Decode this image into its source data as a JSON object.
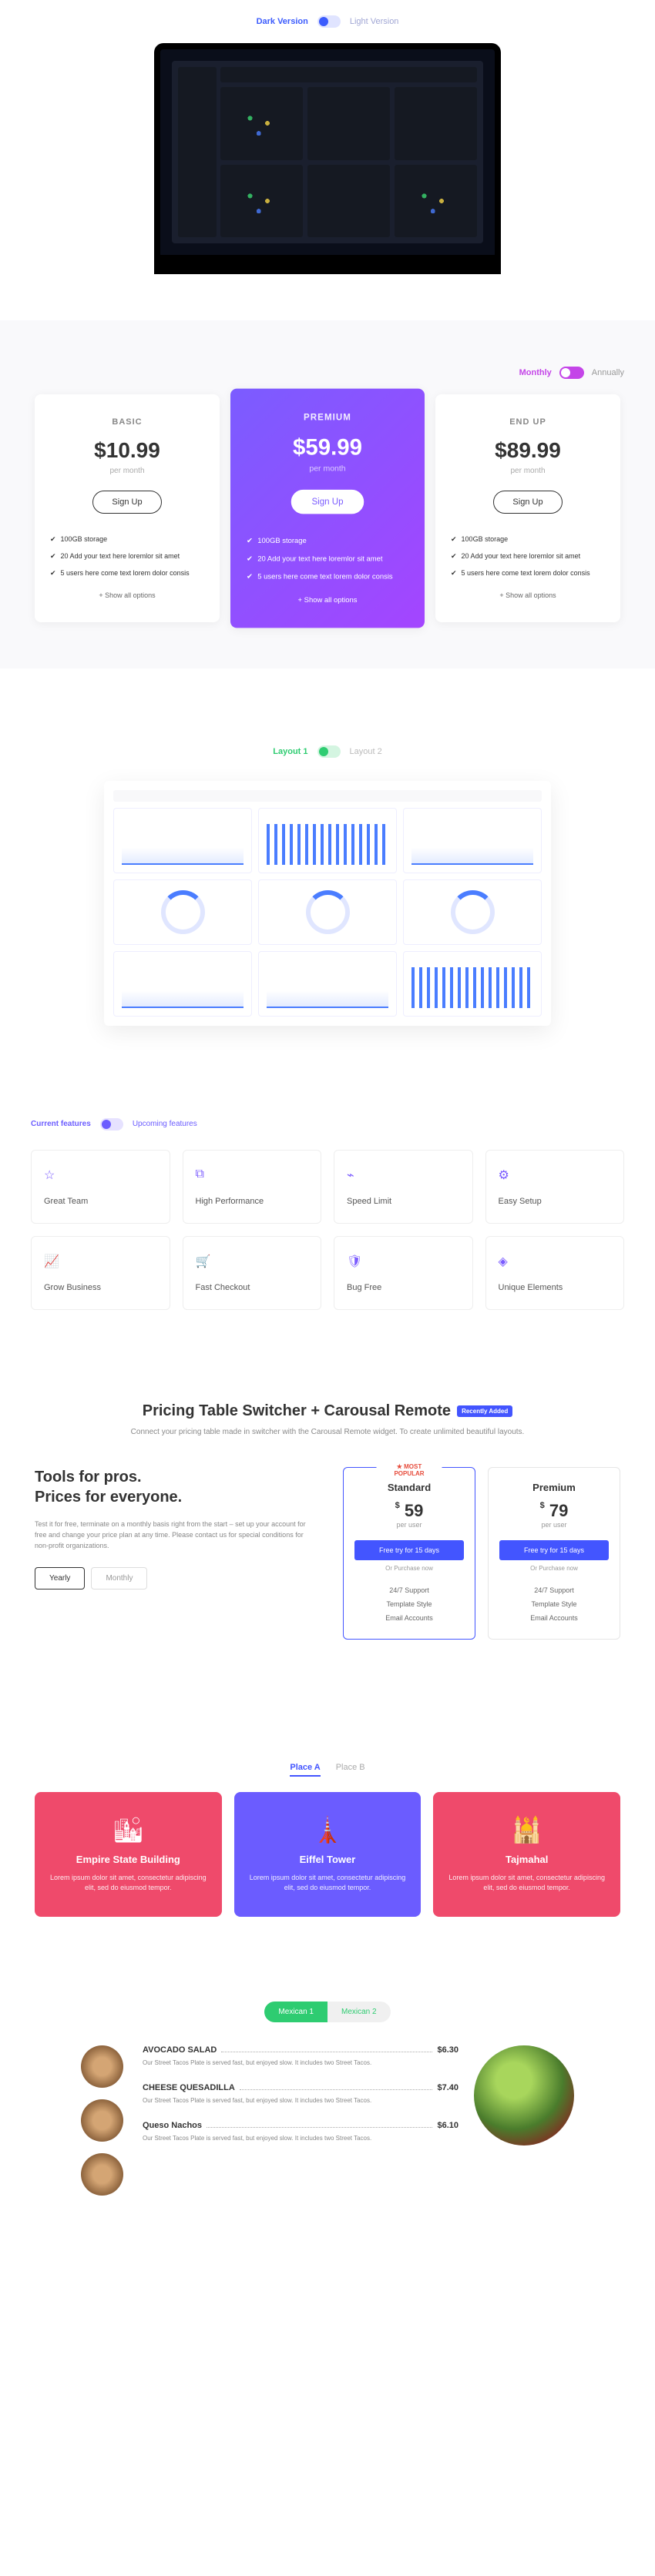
{
  "theme": {
    "dark": "Dark Version",
    "light": "Light Version"
  },
  "billing": {
    "monthly": "Monthly",
    "annually": "Annually"
  },
  "pricing1": [
    {
      "name": "BASIC",
      "price": "$10.99",
      "per": "per month",
      "btn": "Sign Up",
      "features": [
        "100GB storage",
        "20 Add your text here loremlor sit amet",
        "5 users here come text lorem dolor consis"
      ],
      "showAll": "+ Show all options"
    },
    {
      "name": "PREMIUM",
      "price": "$59.99",
      "per": "per month",
      "btn": "Sign Up",
      "features": [
        "100GB storage",
        "20 Add your text here loremlor sit amet",
        "5 users here come text lorem dolor consis"
      ],
      "showAll": "+ Show all options"
    },
    {
      "name": "END UP",
      "price": "$89.99",
      "per": "per month",
      "btn": "Sign Up",
      "features": [
        "100GB storage",
        "20 Add your text here loremlor sit amet",
        "5 users here come text lorem dolor consis"
      ],
      "showAll": "+ Show all options"
    }
  ],
  "layout": {
    "l1": "Layout 1",
    "l2": "Layout 2"
  },
  "featToggle": {
    "current": "Current features",
    "upcoming": "Upcoming features"
  },
  "features": [
    "Great Team",
    "High Performance",
    "Speed Limit",
    "Easy Setup",
    "Grow Business",
    "Fast Checkout",
    "Bug Free",
    "Unique Elements"
  ],
  "switcher": {
    "title": "Pricing Table Switcher + Carousal Remote",
    "badge": "Recently Added",
    "sub": "Connect your pricing table made in switcher with the Carousal Remote widget. To create unlimited beautiful layouts.",
    "left": {
      "h1": "Tools for pros.",
      "h2": "Prices for everyone.",
      "p": "Test it for free, terminate on a monthly basis right from the start – set up your account for free and change your price plan at any time. Please contact us for special conditions for non-profit organizations.",
      "yearly": "Yearly",
      "monthly": "Monthly"
    },
    "cards": [
      {
        "popular": "★ MOST POPULAR",
        "name": "Standard",
        "price": "59",
        "per": "per user",
        "btn": "Free try for 15 days",
        "or": "Or Purchase now",
        "feats": [
          "24/7 Support",
          "Template Style",
          "Email Accounts"
        ]
      },
      {
        "name": "Premium",
        "price": "79",
        "per": "per user",
        "btn": "Free try for 15 days",
        "or": "Or Purchase now",
        "feats": [
          "24/7 Support",
          "Template Style",
          "Email Accounts"
        ]
      }
    ]
  },
  "places": {
    "tabA": "Place A",
    "tabB": "Place B",
    "cards": [
      {
        "name": "Empire State Building",
        "desc": "Lorem ipsum dolor sit amet, consectetur adipiscing elit, sed do eiusmod tempor."
      },
      {
        "name": "Eiffel Tower",
        "desc": "Lorem ipsum dolor sit amet, consectetur adipiscing elit, sed do eiusmod tempor."
      },
      {
        "name": "Tajmahal",
        "desc": "Lorem ipsum dolor sit amet, consectetur adipiscing elit, sed do eiusmod tempor."
      }
    ]
  },
  "menu": {
    "tab1": "Mexican 1",
    "tab2": "Mexican 2",
    "items": [
      {
        "name": "AVOCADO SALAD",
        "price": "$6.30",
        "desc": "Our Street Tacos Plate is served fast, but enjoyed slow. It includes two Street Tacos."
      },
      {
        "name": "CHEESE QUESADILLA",
        "price": "$7.40",
        "desc": "Our Street Tacos Plate is served fast, but enjoyed slow. It includes two Street Tacos."
      },
      {
        "name": "Queso Nachos",
        "price": "$6.10",
        "desc": "Our Street Tacos Plate is served fast, but enjoyed slow. It includes two Street Tacos."
      }
    ]
  }
}
